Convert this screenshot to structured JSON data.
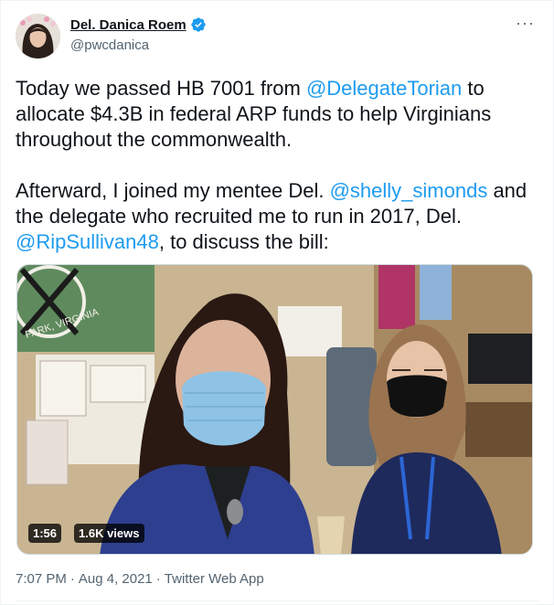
{
  "author": {
    "name": "Del. Danica Roem",
    "handle": "@pwcdanica",
    "verified": true,
    "avatar_icon": "profile-photo-avatar"
  },
  "more_icon": "more-options-icon",
  "more_glyph": "···",
  "tweet": {
    "p1_a": "Today we passed HB 7001 from ",
    "p1_mention": "@DelegateTorian",
    "p1_b": " to allocate $4.3B in federal ARP funds to help Virginians throughout the commonwealth.",
    "p2_a": "Afterward, I joined my mentee Del. ",
    "p2_mention1": "@shelly_simonds",
    "p2_b": " and the delegate who recruited me to run in 2017, Del. ",
    "p2_mention2": "@RipSullivan48",
    "p2_c": ", to discuss the bill:"
  },
  "video": {
    "duration": "1:56",
    "views": "1.6K views",
    "flag_text": "PARK, VIRGINIA"
  },
  "meta": {
    "time": "7:07 PM",
    "sep1": "·",
    "date": "Aug 4, 2021",
    "sep2": "·",
    "app": "Twitter Web App"
  },
  "colors": {
    "link": "#1d9bf0",
    "text": "#0f1419",
    "secondary": "#536471",
    "verified": "#1d9bf0"
  }
}
